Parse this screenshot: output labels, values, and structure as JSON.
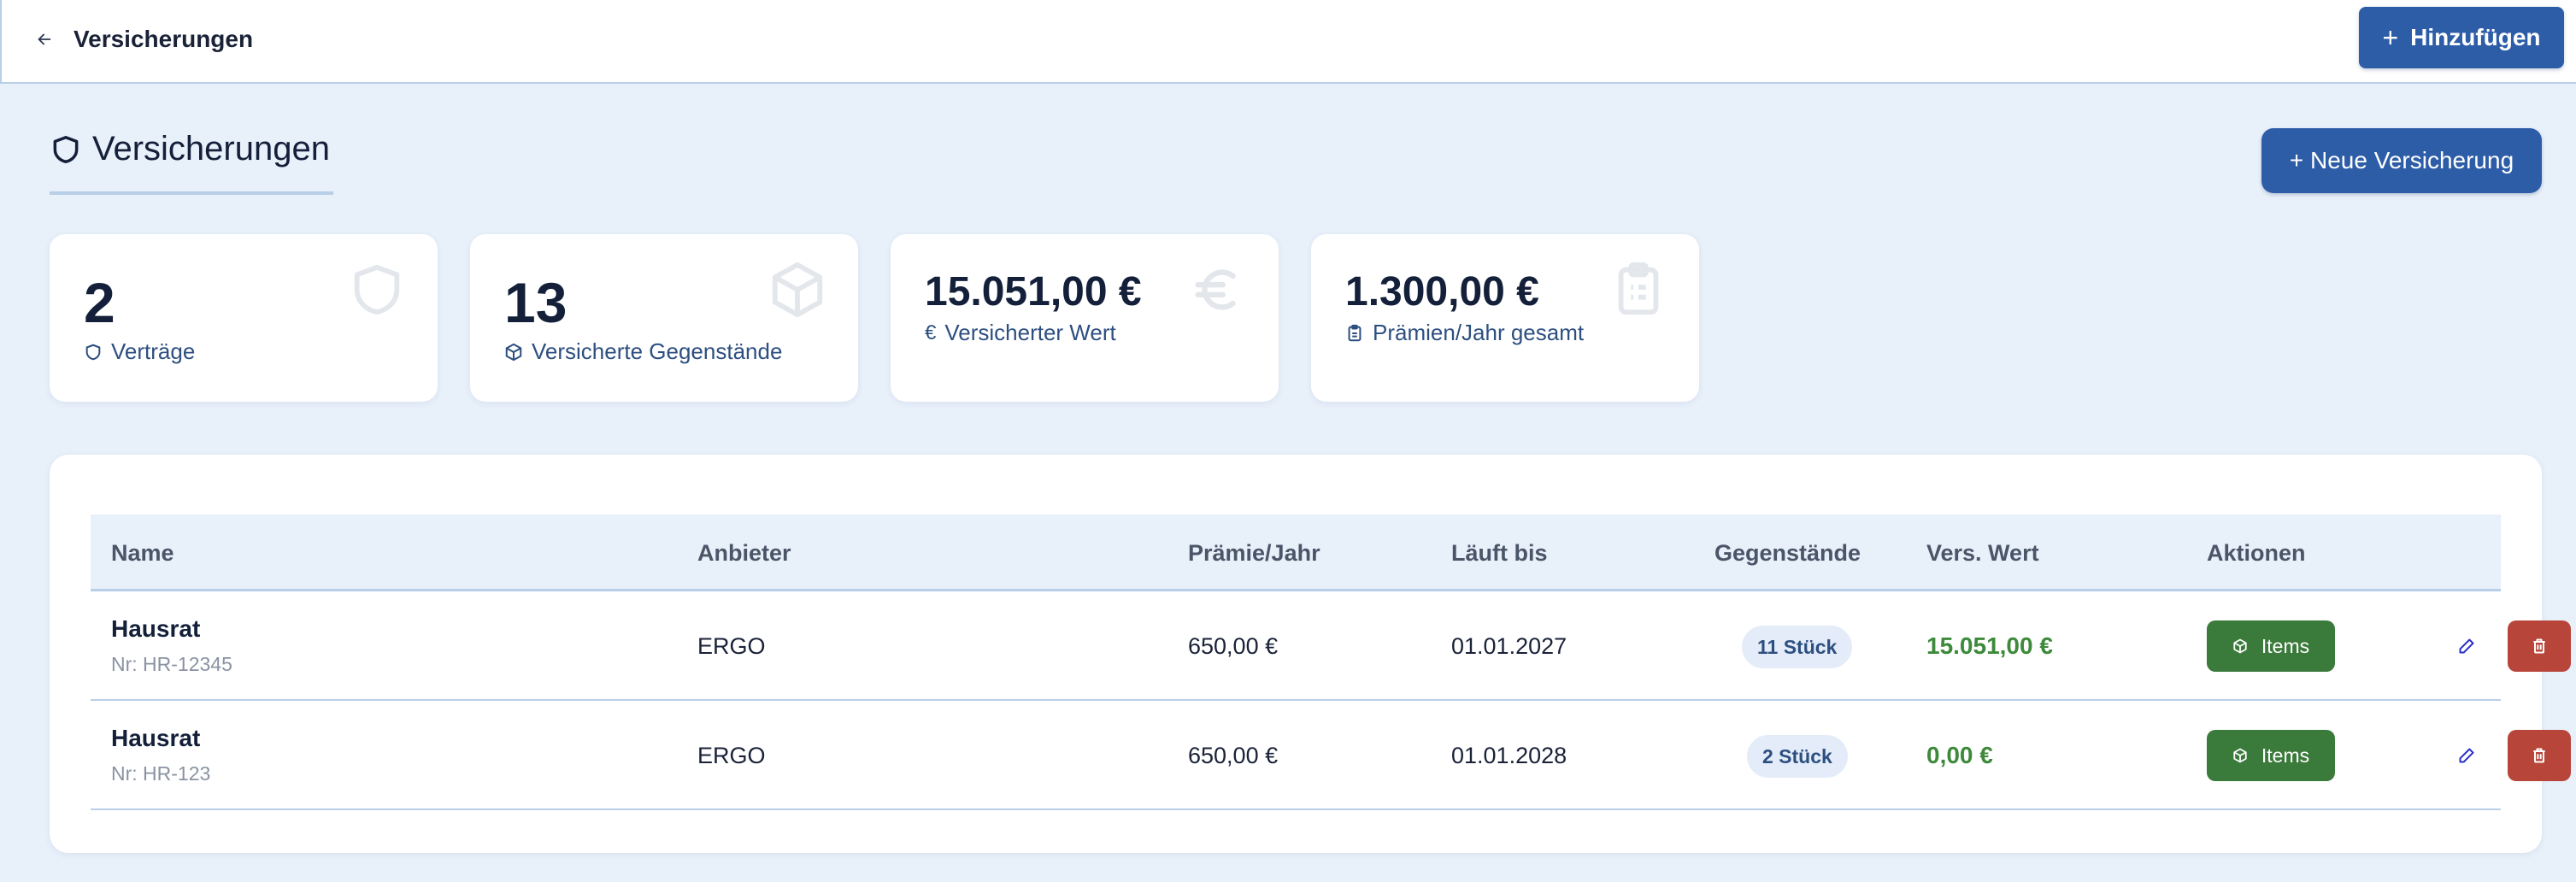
{
  "topbar": {
    "title": "Versicherungen",
    "add_label": "Hinzufügen"
  },
  "heading": {
    "title": "Versicherungen",
    "new_button": "+ Neue Versicherung"
  },
  "stats": [
    {
      "value": "2",
      "label": "Verträge",
      "icon": "shield-icon"
    },
    {
      "value": "13",
      "label": "Versicherte Gegenstände",
      "icon": "box-icon"
    },
    {
      "value": "15.051,00 €",
      "label": "Versicherter Wert",
      "icon": "euro-icon"
    },
    {
      "value": "1.300,00 €",
      "label": "Prämien/Jahr gesamt",
      "icon": "clipboard-icon"
    }
  ],
  "table": {
    "columns": [
      "Name",
      "Anbieter",
      "Prämie/Jahr",
      "Läuft bis",
      "Gegenstände",
      "Vers. Wert",
      "Aktionen"
    ],
    "rows": [
      {
        "name": "Hausrat",
        "number": "Nr: HR-12345",
        "provider": "ERGO",
        "premium": "650,00 €",
        "until": "01.01.2027",
        "items": "11 Stück",
        "value": "15.051,00 €",
        "items_button": "Items"
      },
      {
        "name": "Hausrat",
        "number": "Nr: HR-123",
        "provider": "ERGO",
        "premium": "650,00 €",
        "until": "01.01.2028",
        "items": "2 Stück",
        "value": "0,00 €",
        "items_button": "Items"
      }
    ]
  },
  "colors": {
    "primary": "#2e5da8",
    "success": "#3a7a3a",
    "danger": "#b8453a",
    "background": "#e8f0fa",
    "value_green": "#3e8a3c"
  }
}
